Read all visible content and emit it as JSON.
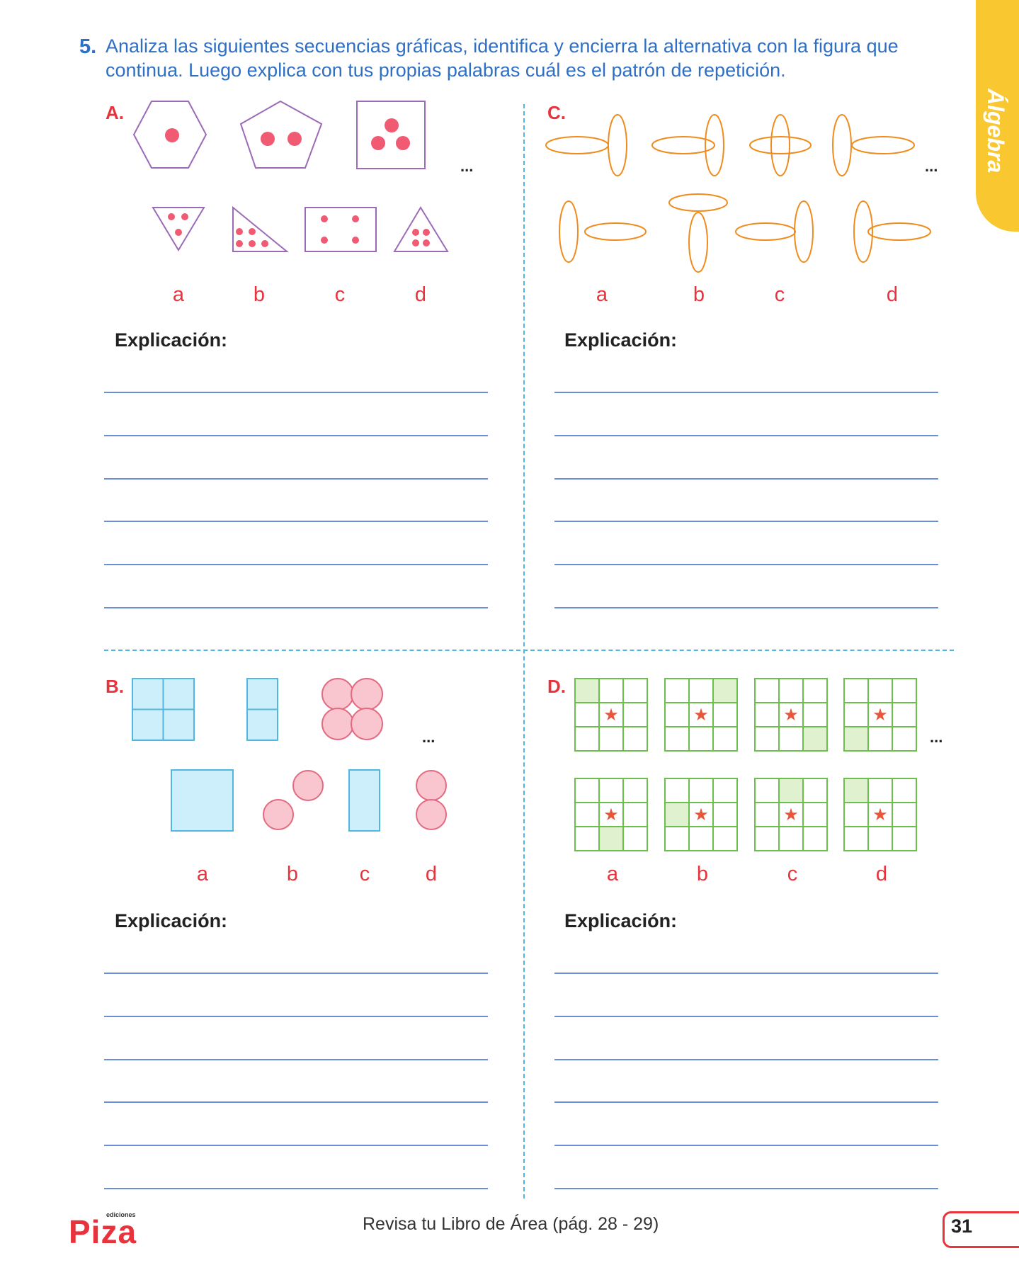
{
  "side_tab": {
    "label": "Álgebra"
  },
  "question": {
    "number": "5.",
    "text": "Analiza las siguientes secuencias gráficas, identifica y encierra la alternativa con la figura que continua. Luego explica con tus propias palabras cuál es el patrón de repetición."
  },
  "sections": {
    "A": {
      "label": "A."
    },
    "B": {
      "label": "B."
    },
    "C": {
      "label": "C."
    },
    "D": {
      "label": "D."
    }
  },
  "options": [
    "a",
    "b",
    "c",
    "d"
  ],
  "ellipsis": "...",
  "explanation_label": "Explicación:",
  "footer": {
    "logo_text": "Piza",
    "logo_small": "ediciones",
    "review_text": "Revisa tu Libro de Área (pág. 28 - 29)",
    "page_number": "31"
  },
  "colors": {
    "accent_blue": "#2f6fc4",
    "accent_red": "#e8333d",
    "tab_yellow": "#f9c72f",
    "shape_purple": "#9b6bb8",
    "dot_pink": "#f05a72",
    "orange": "#f08c1e",
    "light_blue": "#cdeefb",
    "pink_fill": "#f9c6cf",
    "green": "#6dbf4b",
    "green_fill": "#dff1cf",
    "star": "#e9553a"
  }
}
